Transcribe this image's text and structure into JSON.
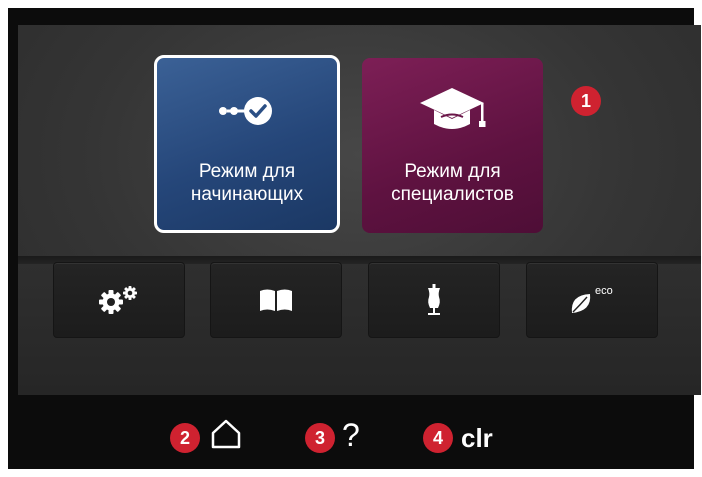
{
  "modes": {
    "beginner": {
      "label": "Режим для\nначинающих",
      "icon": "progress-check-icon",
      "color": "#254679"
    },
    "expert": {
      "label": "Режим для\nспециалистов",
      "icon": "graduation-cap-icon",
      "color": "#5e1240"
    }
  },
  "toolbar": {
    "items": [
      {
        "icon": "settings-gears-icon"
      },
      {
        "icon": "book-icon"
      },
      {
        "icon": "dress-form-icon"
      },
      {
        "icon": "eco-leaf-icon",
        "badge": "eco"
      }
    ]
  },
  "bottom_bar": {
    "home_icon": "home-icon",
    "help_label": "?",
    "clear_label": "clr"
  },
  "callouts": [
    "1",
    "2",
    "3",
    "4"
  ],
  "colors": {
    "callout": "#cf2230",
    "background": "#0c0c0c"
  }
}
